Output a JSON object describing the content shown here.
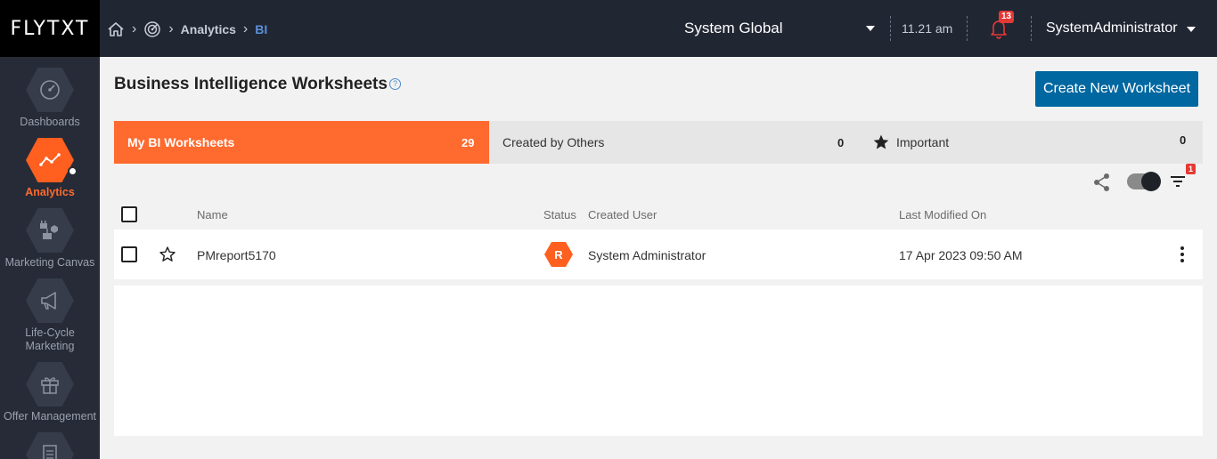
{
  "app": {
    "logo_text": "FLYTXT"
  },
  "breadcrumb": {
    "items": [
      "Analytics",
      "BI"
    ]
  },
  "header": {
    "scope": "System Global",
    "time": "11.21 am",
    "notifications_count": "13",
    "user": "SystemAdministrator"
  },
  "sidebar": {
    "items": [
      {
        "label": "Dashboards",
        "icon": "dashboard-gauge-icon"
      },
      {
        "label": "Analytics",
        "icon": "analytics-chart-icon",
        "active": true
      },
      {
        "label": "Marketing Canvas",
        "icon": "marketing-canvas-icon"
      },
      {
        "label": "Life-Cycle Marketing",
        "icon": "megaphone-icon"
      },
      {
        "label": "Offer Management",
        "icon": "gift-icon"
      },
      {
        "label": "",
        "icon": "document-icon"
      }
    ]
  },
  "page": {
    "title": "Business Intelligence Worksheets",
    "create_button": "Create New Worksheet"
  },
  "tabs": [
    {
      "label": "My BI Worksheets",
      "count": "29",
      "active": true
    },
    {
      "label": "Created by Others",
      "count": "0"
    },
    {
      "label": "Important",
      "count": "0",
      "icon": "star-filled-icon"
    }
  ],
  "toolbar": {
    "filter_badge": "1"
  },
  "table": {
    "columns": {
      "name": "Name",
      "status": "Status",
      "created_user": "Created User",
      "last_modified": "Last Modified On"
    },
    "rows": [
      {
        "name": "PMreport5170",
        "status": "R",
        "created_user": "System Administrator",
        "last_modified": "17 Apr 2023 09:50 AM"
      }
    ]
  },
  "colors": {
    "accent": "#ff6a2e",
    "primary_button": "#0067a0",
    "topbar": "#212633",
    "sidebar": "#262b37"
  }
}
